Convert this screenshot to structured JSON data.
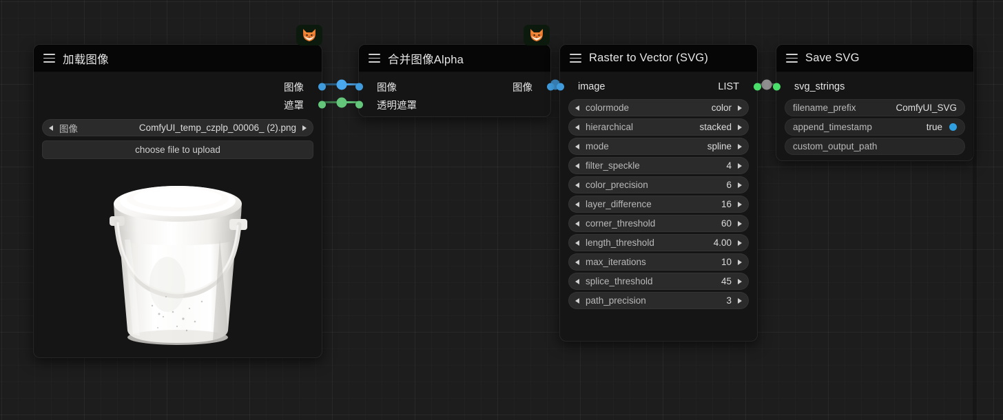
{
  "app": {
    "name": "ComfyUI Node Graph",
    "canvas_background": "#1d1d1d"
  },
  "colors": {
    "image_port": "#3f9bdc",
    "mask_port": "#63c67a",
    "list_port": "#4ade6a",
    "link_blue": "#4a9fe0",
    "link_green": "#63c67a",
    "link_gray": "#9c9c9c",
    "node_body": "#151515",
    "node_header": "#060606",
    "widget": "#2b2b2b",
    "accent_true": "#2f9fe0"
  },
  "nodes": [
    {
      "id": "load-image",
      "title": "加载图像",
      "menu_icon": "hamburger-icon",
      "outputs": [
        {
          "label": "图像",
          "type": "IMAGE",
          "color": "#3f9bdc"
        },
        {
          "label": "遮罩",
          "type": "MASK",
          "color": "#63c67a"
        }
      ],
      "widgets": [
        {
          "kind": "combo",
          "name": "图像",
          "value": "ComfyUI_temp_czplp_00006_ (2).png"
        },
        {
          "kind": "button",
          "label": "choose file to upload"
        }
      ],
      "preview": {
        "alt": "white plastic bucket with lid and handle"
      }
    },
    {
      "id": "merge-image-alpha",
      "title": "合并图像Alpha",
      "menu_icon": "hamburger-icon",
      "badge": "fox-icon",
      "inputs": [
        {
          "label": "图像",
          "type": "IMAGE",
          "color": "#3f9bdc"
        },
        {
          "label": "透明遮罩",
          "type": "MASK",
          "color": "#63c67a"
        }
      ],
      "outputs": [
        {
          "label": "图像",
          "type": "IMAGE",
          "color": "#3f9bdc"
        }
      ],
      "widgets": []
    },
    {
      "id": "raster-to-vector",
      "title": "Raster to Vector (SVG)",
      "menu_icon": "hamburger-icon",
      "badge": "fox-icon",
      "inputs": [
        {
          "label": "image",
          "type": "IMAGE",
          "color": "#3f9bdc"
        }
      ],
      "outputs": [
        {
          "label": "LIST",
          "type": "LIST",
          "color": "#4ade6a"
        }
      ],
      "widgets": [
        {
          "kind": "combo",
          "name": "colormode",
          "value": "color"
        },
        {
          "kind": "combo",
          "name": "hierarchical",
          "value": "stacked"
        },
        {
          "kind": "combo",
          "name": "mode",
          "value": "spline"
        },
        {
          "kind": "combo",
          "name": "filter_speckle",
          "value": "4"
        },
        {
          "kind": "combo",
          "name": "color_precision",
          "value": "6"
        },
        {
          "kind": "combo",
          "name": "layer_difference",
          "value": "16"
        },
        {
          "kind": "combo",
          "name": "corner_threshold",
          "value": "60"
        },
        {
          "kind": "combo",
          "name": "length_threshold",
          "value": "4.00"
        },
        {
          "kind": "combo",
          "name": "max_iterations",
          "value": "10"
        },
        {
          "kind": "combo",
          "name": "splice_threshold",
          "value": "45"
        },
        {
          "kind": "combo",
          "name": "path_precision",
          "value": "3"
        }
      ]
    },
    {
      "id": "save-svg",
      "title": "Save SVG",
      "menu_icon": "hamburger-icon",
      "inputs": [
        {
          "label": "svg_strings",
          "type": "LIST",
          "color": "#4ade6a"
        }
      ],
      "outputs": [],
      "widgets": [
        {
          "kind": "text",
          "name": "filename_prefix",
          "value": "ComfyUI_SVG"
        },
        {
          "kind": "bool",
          "name": "append_timestamp",
          "value": "true"
        },
        {
          "kind": "text",
          "name": "custom_output_path",
          "value": ""
        }
      ]
    }
  ],
  "links": [
    {
      "from": "load-image.图像",
      "to": "merge-image-alpha.图像",
      "color": "#4a9fe0"
    },
    {
      "from": "load-image.遮罩",
      "to": "merge-image-alpha.透明遮罩",
      "color": "#63c67a"
    },
    {
      "from": "merge-image-alpha.图像",
      "to": "raster-to-vector.image",
      "color": "#4a9fe0"
    },
    {
      "from": "raster-to-vector.LIST",
      "to": "save-svg.svg_strings",
      "color": "#9c9c9c"
    }
  ]
}
